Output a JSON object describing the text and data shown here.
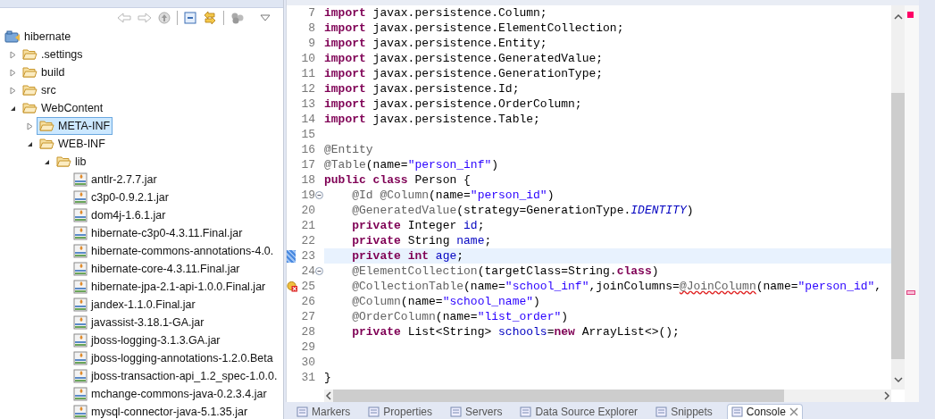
{
  "explorer": {
    "tree": [
      {
        "label": "hibernate",
        "kind": "project",
        "selected": false,
        "children": [
          {
            "label": ".settings",
            "kind": "folder",
            "selected": false,
            "expanded": false
          },
          {
            "label": "build",
            "kind": "folder",
            "selected": false,
            "expanded": false
          },
          {
            "label": "src",
            "kind": "folder",
            "selected": false,
            "expanded": false
          },
          {
            "label": "WebContent",
            "kind": "folder",
            "selected": false,
            "expanded": true,
            "children": [
              {
                "label": "META-INF",
                "kind": "folder",
                "selected": true,
                "expanded": false
              },
              {
                "label": "WEB-INF",
                "kind": "folder",
                "selected": false,
                "expanded": true,
                "children": [
                  {
                    "label": "lib",
                    "kind": "folder",
                    "selected": false,
                    "expanded": true,
                    "children": [
                      {
                        "label": "antlr-2.7.7.jar",
                        "kind": "jar",
                        "selected": false
                      },
                      {
                        "label": "c3p0-0.9.2.1.jar",
                        "kind": "jar",
                        "selected": false
                      },
                      {
                        "label": "dom4j-1.6.1.jar",
                        "kind": "jar",
                        "selected": false
                      },
                      {
                        "label": "hibernate-c3p0-4.3.11.Final.jar",
                        "kind": "jar",
                        "selected": false
                      },
                      {
                        "label": "hibernate-commons-annotations-4.0.",
                        "kind": "jar",
                        "selected": false
                      },
                      {
                        "label": "hibernate-core-4.3.11.Final.jar",
                        "kind": "jar",
                        "selected": false
                      },
                      {
                        "label": "hibernate-jpa-2.1-api-1.0.0.Final.jar",
                        "kind": "jar",
                        "selected": false
                      },
                      {
                        "label": "jandex-1.1.0.Final.jar",
                        "kind": "jar",
                        "selected": false
                      },
                      {
                        "label": "javassist-3.18.1-GA.jar",
                        "kind": "jar",
                        "selected": false
                      },
                      {
                        "label": "jboss-logging-3.1.3.GA.jar",
                        "kind": "jar",
                        "selected": false
                      },
                      {
                        "label": "jboss-logging-annotations-1.2.0.Beta",
                        "kind": "jar",
                        "selected": false
                      },
                      {
                        "label": "jboss-transaction-api_1.2_spec-1.0.0.",
                        "kind": "jar",
                        "selected": false
                      },
                      {
                        "label": "mchange-commons-java-0.2.3.4.jar",
                        "kind": "jar",
                        "selected": false
                      },
                      {
                        "label": "mysql-connector-java-5.1.35.jar",
                        "kind": "jar",
                        "selected": false
                      }
                    ]
                  }
                ]
              }
            ]
          }
        ]
      }
    ]
  },
  "editor": {
    "lines": [
      {
        "num": "7",
        "fold": false,
        "current": false,
        "error": false,
        "segs": [
          {
            "t": "import",
            "kind": "keyword"
          },
          {
            "t": " javax.persistence.Column;",
            "kind": "plain"
          }
        ]
      },
      {
        "num": "8",
        "fold": false,
        "current": false,
        "error": false,
        "segs": [
          {
            "t": "import",
            "kind": "keyword"
          },
          {
            "t": " javax.persistence.ElementCollection;",
            "kind": "plain"
          }
        ]
      },
      {
        "num": "9",
        "fold": false,
        "current": false,
        "error": false,
        "segs": [
          {
            "t": "import",
            "kind": "keyword"
          },
          {
            "t": " javax.persistence.Entity;",
            "kind": "plain"
          }
        ]
      },
      {
        "num": "10",
        "fold": false,
        "current": false,
        "error": false,
        "segs": [
          {
            "t": "import",
            "kind": "keyword"
          },
          {
            "t": " javax.persistence.GeneratedValue;",
            "kind": "plain"
          }
        ]
      },
      {
        "num": "11",
        "fold": false,
        "current": false,
        "error": false,
        "segs": [
          {
            "t": "import",
            "kind": "keyword"
          },
          {
            "t": " javax.persistence.GenerationType;",
            "kind": "plain"
          }
        ]
      },
      {
        "num": "12",
        "fold": false,
        "current": false,
        "error": false,
        "segs": [
          {
            "t": "import",
            "kind": "keyword"
          },
          {
            "t": " javax.persistence.Id;",
            "kind": "plain"
          }
        ]
      },
      {
        "num": "13",
        "fold": false,
        "current": false,
        "error": false,
        "segs": [
          {
            "t": "import",
            "kind": "keyword"
          },
          {
            "t": " javax.persistence.OrderColumn;",
            "kind": "plain"
          }
        ]
      },
      {
        "num": "14",
        "fold": false,
        "current": false,
        "error": false,
        "segs": [
          {
            "t": "import",
            "kind": "keyword"
          },
          {
            "t": " javax.persistence.Table;",
            "kind": "plain"
          }
        ]
      },
      {
        "num": "15",
        "fold": false,
        "current": false,
        "error": false
      },
      {
        "num": "16",
        "fold": false,
        "current": false,
        "error": false,
        "segs": [
          {
            "t": "@Entity",
            "kind": "annotation"
          }
        ]
      },
      {
        "num": "17",
        "fold": false,
        "current": false,
        "error": false,
        "segs": [
          {
            "t": "@Table",
            "kind": "annotation"
          },
          {
            "t": "(name=",
            "kind": "plain"
          },
          {
            "t": "\"person_inf\"",
            "kind": "string"
          },
          {
            "t": ")",
            "kind": "plain"
          }
        ]
      },
      {
        "num": "18",
        "fold": false,
        "current": false,
        "error": false,
        "segs": [
          {
            "t": "public",
            "kind": "keyword"
          },
          {
            "t": " class",
            "kind": "keyword"
          },
          {
            "t": " Person {",
            "kind": "plain"
          }
        ]
      },
      {
        "num": "19",
        "fold": true,
        "current": false,
        "error": false,
        "segs": [
          {
            "t": "    @Id",
            "kind": "annotation"
          },
          {
            "t": " @Column",
            "kind": "annotation"
          },
          {
            "t": "(name=",
            "kind": "plain"
          },
          {
            "t": "\"person_id\"",
            "kind": "string"
          },
          {
            "t": ")",
            "kind": "plain"
          }
        ]
      },
      {
        "num": "20",
        "fold": false,
        "current": false,
        "error": false,
        "segs": [
          {
            "t": "    @GeneratedValue",
            "kind": "annotation"
          },
          {
            "t": "(strategy=GenerationType.",
            "kind": "plain"
          },
          {
            "t": "IDENTITY",
            "kind": "static"
          },
          {
            "t": ")",
            "kind": "plain"
          }
        ]
      },
      {
        "num": "21",
        "fold": false,
        "current": false,
        "error": false,
        "segs": [
          {
            "t": "    private",
            "kind": "keyword"
          },
          {
            "t": " Integer ",
            "kind": "plain"
          },
          {
            "t": "id",
            "kind": "field"
          },
          {
            "t": ";",
            "kind": "plain"
          }
        ]
      },
      {
        "num": "22",
        "fold": false,
        "current": false,
        "error": false,
        "segs": [
          {
            "t": "    private",
            "kind": "keyword"
          },
          {
            "t": " String ",
            "kind": "plain"
          },
          {
            "t": "name",
            "kind": "field"
          },
          {
            "t": ";",
            "kind": "plain"
          }
        ]
      },
      {
        "num": "23",
        "fold": false,
        "current": true,
        "error": false,
        "segs": [
          {
            "t": "    private",
            "kind": "keyword"
          },
          {
            "t": " int",
            "kind": "keyword"
          },
          {
            "t": " age",
            "kind": "field"
          },
          {
            "t": ";",
            "kind": "plain"
          }
        ]
      },
      {
        "num": "24",
        "fold": true,
        "current": false,
        "error": false,
        "segs": [
          {
            "t": "    @ElementCollection",
            "kind": "annotation"
          },
          {
            "t": "(targetClass=String.",
            "kind": "plain"
          },
          {
            "t": "class",
            "kind": "keyword"
          },
          {
            "t": ")",
            "kind": "plain"
          }
        ]
      },
      {
        "num": "25",
        "fold": false,
        "current": false,
        "error": true,
        "segs": [
          {
            "t": "    @CollectionTable",
            "kind": "annotation"
          },
          {
            "t": "(name=",
            "kind": "plain"
          },
          {
            "t": "\"school_inf\"",
            "kind": "string"
          },
          {
            "t": ",joinColumns=",
            "kind": "plain"
          },
          {
            "t": "@JoinColumn",
            "kind": "error"
          },
          {
            "t": "(name=",
            "kind": "plain"
          },
          {
            "t": "\"person_id\"",
            "kind": "string"
          },
          {
            "t": ",",
            "kind": "plain"
          }
        ]
      },
      {
        "num": "26",
        "fold": false,
        "current": false,
        "error": false,
        "segs": [
          {
            "t": "    @Column",
            "kind": "annotation"
          },
          {
            "t": "(name=",
            "kind": "plain"
          },
          {
            "t": "\"school_name\"",
            "kind": "string"
          },
          {
            "t": ")",
            "kind": "plain"
          }
        ]
      },
      {
        "num": "27",
        "fold": false,
        "current": false,
        "error": false,
        "segs": [
          {
            "t": "    @OrderColumn",
            "kind": "annotation"
          },
          {
            "t": "(name=",
            "kind": "plain"
          },
          {
            "t": "\"list_order\"",
            "kind": "string"
          },
          {
            "t": ")",
            "kind": "plain"
          }
        ]
      },
      {
        "num": "28",
        "fold": false,
        "current": false,
        "error": false,
        "segs": [
          {
            "t": "    private",
            "kind": "keyword"
          },
          {
            "t": " List<String> ",
            "kind": "plain"
          },
          {
            "t": "schools",
            "kind": "field"
          },
          {
            "t": "=",
            "kind": "plain"
          },
          {
            "t": "new",
            "kind": "keyword"
          },
          {
            "t": " ArrayList<>();",
            "kind": "plain"
          }
        ]
      },
      {
        "num": "29",
        "fold": false,
        "current": false,
        "error": false
      },
      {
        "num": "30",
        "fold": false,
        "current": false,
        "error": false
      },
      {
        "num": "31",
        "fold": false,
        "current": false,
        "error": false,
        "segs": [
          {
            "t": "}",
            "kind": "plain"
          }
        ]
      }
    ]
  },
  "bottom_tabs": [
    {
      "label": "Markers",
      "selected": false,
      "closable": false
    },
    {
      "label": "Properties",
      "selected": false,
      "closable": false
    },
    {
      "label": "Servers",
      "selected": false,
      "closable": false
    },
    {
      "label": "Data Source Explorer",
      "selected": false,
      "closable": false
    },
    {
      "label": "Snippets",
      "selected": false,
      "closable": false
    },
    {
      "label": "Console",
      "selected": true,
      "closable": true
    }
  ]
}
